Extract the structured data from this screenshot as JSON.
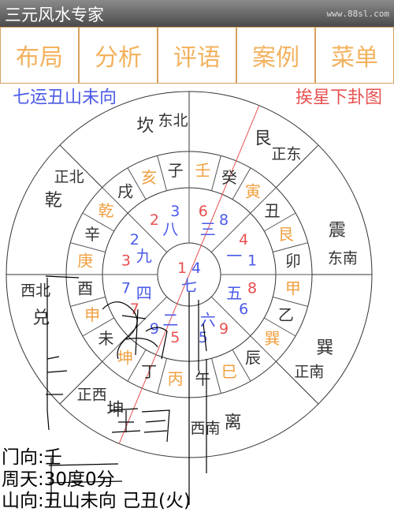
{
  "app": {
    "title": "三元风水专家",
    "site": "www.88sl.com"
  },
  "tabs": [
    "布局",
    "分析",
    "评语",
    "案例",
    "菜单"
  ],
  "header": {
    "left": "七运丑山未向",
    "right": "挨星下卦图"
  },
  "colors": {
    "blue": "#4a5ae8",
    "red": "#e85050",
    "orange": "#f0a040",
    "tabtext": "#f3b25e"
  },
  "directions": [
    "西南",
    "坤",
    "正西",
    "兑",
    "西北",
    "乾",
    "正北",
    "坎",
    "东北",
    "艮",
    "正东",
    "震",
    "东南",
    "巽",
    "正南",
    "离"
  ],
  "mountains_orange": [
    "坤",
    "申",
    "庚",
    "乾",
    "亥",
    "壬",
    "寅",
    "艮",
    "甲",
    "巽",
    "巳",
    "丙"
  ],
  "mountains_black": [
    "未",
    "酉",
    "辛",
    "戌",
    "子",
    "癸",
    "丑",
    "卯",
    "乙",
    "辰",
    "午",
    "丁"
  ],
  "palaces": [
    {
      "mountain": "5",
      "water": "9",
      "period": "二"
    },
    {
      "mountain": "7",
      "water": "7",
      "period": "四"
    },
    {
      "mountain": "3",
      "water": "2",
      "period": "九"
    },
    {
      "mountain": "2",
      "water": "3",
      "period": "八"
    },
    {
      "mountain": "6",
      "water": "8",
      "period": "三"
    },
    {
      "mountain": "4",
      "water": "1",
      "period": "一"
    },
    {
      "mountain": "8",
      "water": "6",
      "period": "五"
    },
    {
      "mountain": "9",
      "water": "5",
      "period": "六"
    },
    {
      "mountain": "1",
      "water": "4",
      "period": "七"
    }
  ],
  "info": {
    "gate": "门向:壬",
    "degree": "周天:30度0分",
    "mountain_direction": "山向:丑山未向 己丑(火)"
  }
}
